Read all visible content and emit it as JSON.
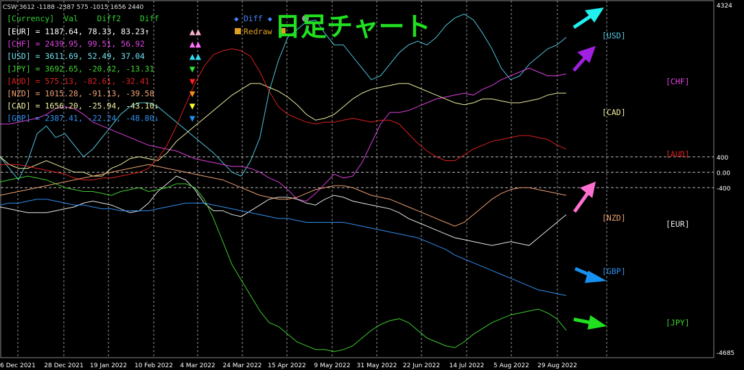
{
  "window": {
    "indicator_header": "CSW 3612 -1188 -2387 575 -1015 1656 2440"
  },
  "table": {
    "header": "[Currency]  Val    Diff2    Diff",
    "rows": [
      {
        "text": "[EUR] = 1187.64,  78.33,  83.23↑",
        "color": "#ffffff",
        "mark_color": "#ffb0c8",
        "mark": "▲▲"
      },
      {
        "text": "[CHF] = 2439.95,  99.51,  56.92",
        "color": "#e040e0",
        "mark_color": "#ff70ff",
        "mark": "▲▲"
      },
      {
        "text": "[USD] = 3611.69,  52.49,  37.04",
        "color": "#70e0f0",
        "mark_color": "#30e0f0",
        "mark": "▲▲"
      },
      {
        "text": "[JPY] = 3692.65, -20.42, -13.31",
        "color": "#40d030",
        "mark_color": "#30e030",
        "mark": "▼"
      },
      {
        "text": "[AUD] =  575.13, -82.61, -32.41",
        "color": "#e02020",
        "mark_color": "#ff2020",
        "mark": "▼"
      },
      {
        "text": "[NZD] = 1015.28, -91.13, -39.58",
        "color": "#f0a070",
        "mark_color": "#f09020",
        "mark": "▼"
      },
      {
        "text": "[CAD] = 1656.20, -25.94, -43.10↓",
        "color": "#f0f0a0",
        "mark_color": "#ffff30",
        "mark": "▼"
      },
      {
        "text": "[GBP] = 2387.41, -22.24, -48.80↓",
        "color": "#3090f0",
        "mark_color": "#2090f0",
        "mark": "▼"
      }
    ]
  },
  "buttons": {
    "diff_label": "Diff",
    "redraw_label": "Redraw"
  },
  "overlay_title": "日足チャート",
  "chart_data": {
    "type": "line",
    "y_axis_labels": [
      {
        "label": "4324",
        "value": 4324
      },
      {
        "label": "400",
        "value": 400
      },
      {
        "label": "0.00",
        "value": 0
      },
      {
        "label": "-400",
        "value": -400
      },
      {
        "label": "-4685",
        "value": -4685
      }
    ],
    "ylim": [
      -4685,
      4324
    ],
    "x_labels": [
      "6 Dec 2021",
      "28 Dec 2021",
      "19 Jan 2022",
      "10 Feb 2022",
      "4 Mar 2022",
      "24 Mar 2022",
      "15 Apr 2022",
      "9 May 2022",
      "31 May 2022",
      "22 Jun 2022",
      "14 Jul 2022",
      "5 Aug 2022",
      "29 Aug 2022"
    ],
    "grid": true,
    "series": [
      {
        "name": "[USD]",
        "color": "#50c8e0",
        "values": [
          400,
          100,
          -200,
          300,
          1000,
          1200,
          900,
          1000,
          700,
          400,
          600,
          900,
          1200,
          1500,
          1700,
          1800,
          1800,
          1700,
          1500,
          1300,
          1100,
          900,
          700,
          500,
          250,
          0,
          -100,
          300,
          900,
          2100,
          2900,
          3500,
          3700,
          3900,
          3950,
          3600,
          3300,
          3300,
          3000,
          2700,
          2400,
          2500,
          2800,
          3100,
          3300,
          3400,
          3300,
          3500,
          3800,
          4000,
          4100,
          3950,
          3600,
          3200,
          2700,
          2400,
          2500,
          2800,
          3000,
          3200,
          3300,
          3500
        ]
      },
      {
        "name": "[CHF]",
        "color": "#e040e0",
        "values": [
          1250,
          1250,
          1300,
          1350,
          1400,
          1500,
          1650,
          1700,
          1650,
          1500,
          1300,
          1200,
          1100,
          1000,
          900,
          800,
          700,
          650,
          600,
          550,
          450,
          350,
          300,
          250,
          200,
          150,
          150,
          100,
          0,
          -150,
          -250,
          -450,
          -700,
          -750,
          -550,
          -300,
          -50,
          -150,
          -100,
          250,
          750,
          1250,
          1550,
          1550,
          1600,
          1700,
          1800,
          1900,
          1950,
          2000,
          2050,
          2000,
          2150,
          2250,
          2400,
          2500,
          2600,
          2700,
          2600,
          2500,
          2500,
          2550
        ]
      },
      {
        "name": "[CAD]",
        "color": "#f0f0a0",
        "values": [
          400,
          200,
          100,
          100,
          200,
          300,
          200,
          100,
          0,
          0,
          -100,
          -100,
          100,
          200,
          350,
          400,
          350,
          300,
          500,
          800,
          1000,
          1200,
          1400,
          1600,
          1800,
          2000,
          2150,
          2300,
          2300,
          2200,
          2100,
          1950,
          1750,
          1500,
          1350,
          1400,
          1500,
          1700,
          1900,
          2050,
          2150,
          2200,
          2250,
          2300,
          2300,
          2200,
          2100,
          2000,
          1900,
          1800,
          1750,
          1800,
          1900,
          1900,
          1850,
          1800,
          1800,
          1850,
          1900,
          2000,
          2050,
          2050
        ]
      },
      {
        "name": "[AUD]",
        "color": "#e02020",
        "values": [
          200,
          200,
          200,
          150,
          100,
          50,
          0,
          -50,
          -150,
          -200,
          -200,
          -150,
          -150,
          -100,
          -50,
          0,
          100,
          350,
          700,
          1200,
          1750,
          2300,
          2750,
          3050,
          3150,
          3200,
          3150,
          3000,
          2600,
          2100,
          1700,
          1500,
          1400,
          1300,
          1250,
          1300,
          1300,
          1350,
          1400,
          1350,
          1300,
          1350,
          1350,
          1250,
          1000,
          750,
          550,
          400,
          300,
          300,
          450,
          600,
          700,
          800,
          850,
          900,
          950,
          950,
          900,
          850,
          700,
          600
        ]
      },
      {
        "name": "[EUR]",
        "color": "#e8e8e8",
        "values": [
          -900,
          -950,
          -1000,
          -1050,
          -1050,
          -1050,
          -1000,
          -950,
          -900,
          -800,
          -750,
          -800,
          -850,
          -950,
          -1050,
          -1000,
          -800,
          -500,
          -300,
          -100,
          -200,
          -450,
          -800,
          -1000,
          -1000,
          -1100,
          -1150,
          -1000,
          -850,
          -700,
          -650,
          -650,
          -700,
          -800,
          -850,
          -700,
          -600,
          -650,
          -750,
          -800,
          -850,
          -900,
          -950,
          -1050,
          -1200,
          -1300,
          -1400,
          -1500,
          -1600,
          -1700,
          -1750,
          -1800,
          -1850,
          -1900,
          -1850,
          -1800,
          -1850,
          -1900,
          -1700,
          -1500,
          -1300,
          -1100
        ]
      },
      {
        "name": "[NZD]",
        "color": "#f0a070",
        "values": [
          -600,
          -550,
          -500,
          -450,
          -400,
          -350,
          -300,
          -250,
          -200,
          -150,
          -100,
          -50,
          0,
          50,
          100,
          150,
          200,
          150,
          100,
          50,
          0,
          -50,
          -100,
          -150,
          -200,
          -300,
          -400,
          -500,
          -600,
          -650,
          -700,
          -700,
          -650,
          -550,
          -450,
          -400,
          -350,
          -350,
          -400,
          -500,
          -600,
          -650,
          -700,
          -800,
          -900,
          -1000,
          -1100,
          -1200,
          -1300,
          -1400,
          -1300,
          -1100,
          -900,
          -700,
          -550,
          -450,
          -400,
          -400,
          -450,
          -500,
          -550,
          -600
        ]
      },
      {
        "name": "[GBP]",
        "color": "#3090f0",
        "values": [
          -850,
          -800,
          -800,
          -750,
          -700,
          -700,
          -750,
          -800,
          -850,
          -850,
          -900,
          -950,
          -950,
          -1000,
          -1000,
          -1000,
          -1000,
          -950,
          -900,
          -850,
          -800,
          -800,
          -800,
          -850,
          -900,
          -950,
          -1000,
          -1050,
          -1100,
          -1150,
          -1200,
          -1200,
          -1250,
          -1300,
          -1300,
          -1300,
          -1300,
          -1300,
          -1350,
          -1400,
          -1450,
          -1500,
          -1550,
          -1600,
          -1650,
          -1700,
          -1800,
          -1900,
          -2000,
          -2150,
          -2250,
          -2350,
          -2450,
          -2550,
          -2650,
          -2750,
          -2850,
          -2950,
          -3050,
          -3100,
          -3150,
          -3200
        ]
      },
      {
        "name": "[JPY]",
        "color": "#40d030",
        "values": [
          -250,
          -200,
          -150,
          -100,
          -150,
          -200,
          -300,
          -400,
          -450,
          -500,
          -500,
          -550,
          -600,
          -500,
          -450,
          -400,
          -500,
          -450,
          -400,
          -300,
          -300,
          -400,
          -700,
          -1200,
          -1800,
          -2400,
          -2800,
          -3200,
          -3600,
          -3900,
          -4000,
          -4200,
          -4400,
          -4500,
          -4600,
          -4600,
          -4650,
          -4600,
          -4500,
          -4300,
          -4100,
          -3950,
          -3850,
          -3800,
          -3900,
          -4100,
          -4300,
          -4400,
          -4500,
          -4550,
          -4400,
          -4200,
          -4050,
          -3900,
          -3800,
          -3700,
          -3650,
          -3600,
          -3550,
          -3650,
          -3800,
          -4100
        ]
      }
    ],
    "right_labels": [
      "[USD]",
      "[CHF]",
      "[CAD]",
      "[AUD]",
      "[NZD]",
      "[EUR]",
      "[GBP]",
      "[JPY]"
    ]
  }
}
